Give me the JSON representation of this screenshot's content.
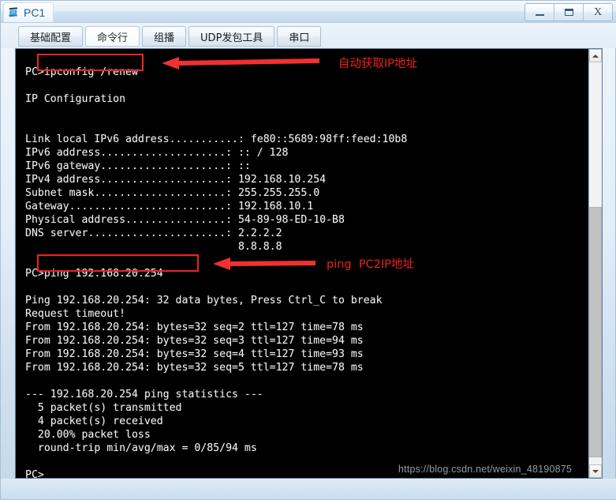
{
  "window": {
    "title": "PC1",
    "icon": "pc-device-icon",
    "controls": [
      {
        "name": "minimize-button",
        "label": "—"
      },
      {
        "name": "maximize-button",
        "label": "□"
      },
      {
        "name": "close-button",
        "label": "X"
      }
    ]
  },
  "tabs": [
    {
      "label": "基础配置",
      "active": false
    },
    {
      "label": "命令行",
      "active": true
    },
    {
      "label": "组播",
      "active": false
    },
    {
      "label": "UDP发包工具",
      "active": false
    },
    {
      "label": "串口",
      "active": false
    }
  ],
  "terminal": {
    "prompt": "PC>",
    "lines": [
      "PC>ipconfig /renew",
      "",
      "IP Configuration",
      "",
      "",
      "Link local IPv6 address...........: fe80::5689:98ff:feed:10b8",
      "IPv6 address....................: :: / 128",
      "IPv6 gateway....................: ::",
      "IPv4 address....................: 192.168.10.254",
      "Subnet mask.....................: 255.255.255.0",
      "Gateway.........................: 192.168.10.1",
      "Physical address................: 54-89-98-ED-10-B8",
      "DNS server......................: 2.2.2.2",
      "                                  8.8.8.8",
      "",
      "PC>ping 192.168.20.254",
      "",
      "Ping 192.168.20.254: 32 data bytes, Press Ctrl_C to break",
      "Request timeout!",
      "From 192.168.20.254: bytes=32 seq=2 ttl=127 time=78 ms",
      "From 192.168.20.254: bytes=32 seq=3 ttl=127 time=94 ms",
      "From 192.168.20.254: bytes=32 seq=4 ttl=127 time=93 ms",
      "From 192.168.20.254: bytes=32 seq=5 ttl=127 time=78 ms",
      "",
      "--- 192.168.20.254 ping statistics ---",
      "  5 packet(s) transmitted",
      "  4 packet(s) received",
      "  20.00% packet loss",
      "  round-trip min/avg/max = 0/85/94 ms",
      "",
      "PC>"
    ],
    "ipconfig": {
      "command": "ipconfig /renew",
      "header": "IP Configuration",
      "link_local_ipv6": "fe80::5689:98ff:feed:10b8",
      "ipv6_address": ":: / 128",
      "ipv6_gateway": "::",
      "ipv4_address": "192.168.10.254",
      "subnet_mask": "255.255.255.0",
      "gateway": "192.168.10.1",
      "physical_address": "54-89-98-ED-10-B8",
      "dns_servers": [
        "2.2.2.2",
        "8.8.8.8"
      ]
    },
    "ping": {
      "command": "ping 192.168.20.254",
      "target": "192.168.20.254",
      "data_bytes": 32,
      "replies": [
        {
          "seq": 2,
          "bytes": 32,
          "ttl": 127,
          "time_ms": 78
        },
        {
          "seq": 3,
          "bytes": 32,
          "ttl": 127,
          "time_ms": 94
        },
        {
          "seq": 4,
          "bytes": 32,
          "ttl": 127,
          "time_ms": 93
        },
        {
          "seq": 5,
          "bytes": 32,
          "ttl": 127,
          "time_ms": 78
        }
      ],
      "timeout_line": "Request timeout!",
      "stats": {
        "transmitted": 5,
        "received": 4,
        "packet_loss": "20.00%",
        "round_trip": "0/85/94 ms"
      }
    }
  },
  "annotations": [
    {
      "name": "annotation-ipconfig",
      "text": "自动获取IP地址",
      "color": "#ee2020"
    },
    {
      "name": "annotation-ping",
      "text": "ping  PC2IP地址",
      "color": "#ee2020"
    }
  ],
  "scrollbar": {
    "up_arrow": "▲",
    "down_arrow": "▼"
  },
  "watermark": "https://blog.csdn.net/weixin_48190875"
}
